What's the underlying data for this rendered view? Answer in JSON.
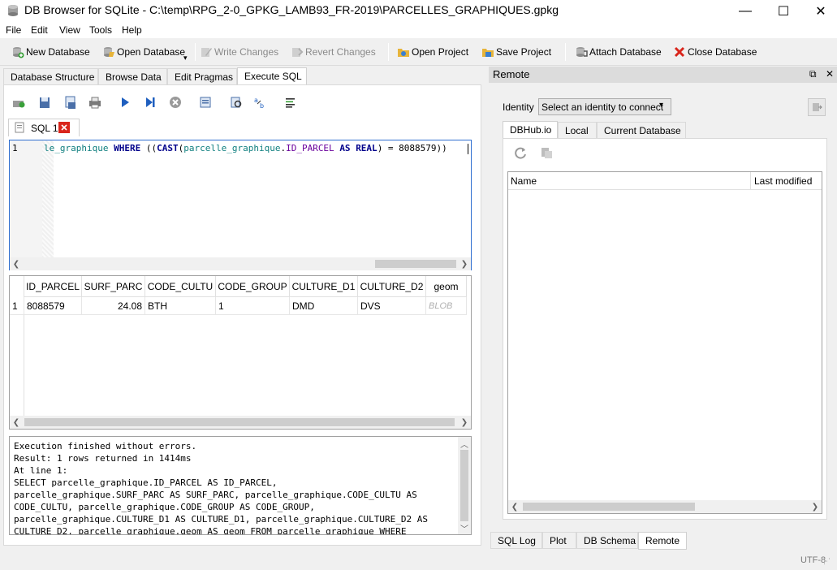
{
  "window": {
    "title": "DB Browser for SQLite - C:\\temp\\RPG_2-0_GPKG_LAMB93_FR-2019\\PARCELLES_GRAPHIQUES.gpkg",
    "minimize": "—",
    "maximize": "☐",
    "close": "✕"
  },
  "menu": [
    "File",
    "Edit",
    "View",
    "Tools",
    "Help"
  ],
  "toolbar": {
    "new_database": "New Database",
    "open_database": "Open Database",
    "write_changes": "Write Changes",
    "revert_changes": "Revert Changes",
    "open_project": "Open Project",
    "save_project": "Save Project",
    "attach_database": "Attach Database",
    "close_database": "Close Database"
  },
  "main_tabs": [
    "Database Structure",
    "Browse Data",
    "Edit Pragmas",
    "Execute SQL"
  ],
  "sql_tab": {
    "label": "SQL 1"
  },
  "editor": {
    "line_number": "1",
    "code_parts": [
      {
        "t": "le_graphique",
        "c": "id"
      },
      {
        "t": " ",
        "c": ""
      },
      {
        "t": "WHERE",
        "c": "kw"
      },
      {
        "t": " ((",
        "c": ""
      },
      {
        "t": "CAST",
        "c": "fn"
      },
      {
        "t": "(",
        "c": ""
      },
      {
        "t": "parcelle_graphique",
        "c": "id"
      },
      {
        "t": ".",
        "c": ""
      },
      {
        "t": "ID_PARCEL",
        "c": "col"
      },
      {
        "t": " ",
        "c": ""
      },
      {
        "t": "AS",
        "c": "kw"
      },
      {
        "t": " ",
        "c": ""
      },
      {
        "t": "REAL",
        "c": "kw"
      },
      {
        "t": ") = 8088579))",
        "c": ""
      }
    ]
  },
  "grid": {
    "columns": [
      "ID_PARCEL",
      "SURF_PARC",
      "CODE_CULTU",
      "CODE_GROUP",
      "CULTURE_D1",
      "CULTURE_D2",
      "geom"
    ],
    "rows": [
      {
        "num": "1",
        "cells": [
          "8088579",
          "24.08",
          "BTH",
          "1",
          "DMD",
          "DVS",
          "BLOB"
        ]
      }
    ]
  },
  "messages": {
    "text": "Execution finished without errors.\nResult: 1 rows returned in 1414ms\nAt line 1:\nSELECT parcelle_graphique.ID_PARCEL AS ID_PARCEL,\nparcelle_graphique.SURF_PARC AS SURF_PARC, parcelle_graphique.CODE_CULTU AS\nCODE_CULTU, parcelle_graphique.CODE_GROUP AS CODE_GROUP,\nparcelle_graphique.CULTURE_D1 AS CULTURE_D1, parcelle_graphique.CULTURE_D2 AS\nCULTURE_D2, parcelle_graphique.geom AS geom FROM parcelle_graphique WHERE"
  },
  "remote": {
    "title": "Remote",
    "identity_label": "Identity",
    "identity_value": "Select an identity to connect",
    "tabs": [
      "DBHub.io",
      "Local",
      "Current Database"
    ],
    "columns": [
      "Name",
      "Last modified"
    ]
  },
  "bottom_tabs": [
    "SQL Log",
    "Plot",
    "DB Schema",
    "Remote"
  ],
  "status": {
    "encoding": "UTF-8"
  },
  "colors": {
    "accent_border": "#2f6fd0",
    "close_red": "#d9261c",
    "play_blue": "#1f5fbf"
  }
}
